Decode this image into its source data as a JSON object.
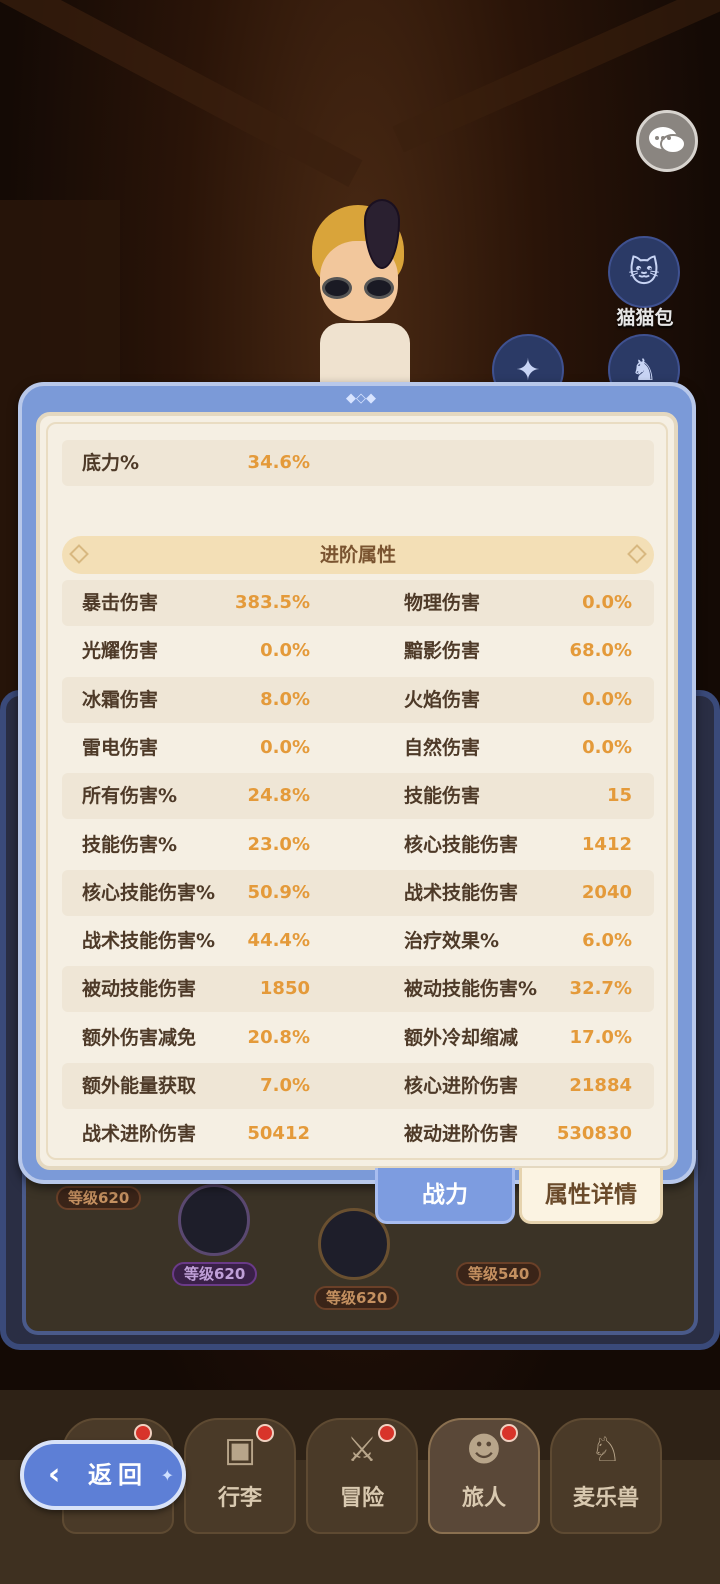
{
  "colors": {
    "modal_frame": "#7b9ad8",
    "modal_body": "#f5efe3",
    "label_text": "#4e3a28",
    "value_text": "#e49a3a",
    "section_header_bg": "#f3dfb6",
    "active_tab": "#7d9ce0",
    "back_button": "#5d7fd6"
  },
  "side_buttons": {
    "chat_icon": "chat-bubbles-icon",
    "cat_bag_label": "猫猫包"
  },
  "stats": {
    "top_row": {
      "label": "底力%",
      "value": "34.6%"
    },
    "section_title": "进阶属性",
    "rows": [
      {
        "l1": "暴击伤害",
        "v1": "383.5%",
        "l2": "物理伤害",
        "v2": "0.0%"
      },
      {
        "l1": "光耀伤害",
        "v1": "0.0%",
        "l2": "黯影伤害",
        "v2": "68.0%"
      },
      {
        "l1": "冰霜伤害",
        "v1": "8.0%",
        "l2": "火焰伤害",
        "v2": "0.0%"
      },
      {
        "l1": "雷电伤害",
        "v1": "0.0%",
        "l2": "自然伤害",
        "v2": "0.0%"
      },
      {
        "l1": "所有伤害%",
        "v1": "24.8%",
        "l2": "技能伤害",
        "v2": "15"
      },
      {
        "l1": "技能伤害%",
        "v1": "23.0%",
        "l2": "核心技能伤害",
        "v2": "1412"
      },
      {
        "l1": "核心技能伤害%",
        "v1": "50.9%",
        "l2": "战术技能伤害",
        "v2": "2040"
      },
      {
        "l1": "战术技能伤害%",
        "v1": "44.4%",
        "l2": "治疗效果%",
        "v2": "6.0%"
      },
      {
        "l1": "被动技能伤害",
        "v1": "1850",
        "l2": "被动技能伤害%",
        "v2": "32.7%"
      },
      {
        "l1": "额外伤害减免",
        "v1": "20.8%",
        "l2": "额外冷却缩减",
        "v2": "17.0%"
      },
      {
        "l1": "额外能量获取",
        "v1": "7.0%",
        "l2": "核心进阶伤害",
        "v2": "21884"
      },
      {
        "l1": "战术进阶伤害",
        "v1": "50412",
        "l2": "被动进阶伤害",
        "v2": "530830"
      }
    ]
  },
  "tabs": {
    "power": "战力",
    "attribute_detail": "属性详情"
  },
  "pets": {
    "level_1": "等级620",
    "level_2": "等级620",
    "level_3": "等级620",
    "level_4": "等级540"
  },
  "bottom_nav": {
    "back": "返回",
    "items": [
      "行李",
      "冒险",
      "旅人",
      "麦乐兽"
    ]
  }
}
